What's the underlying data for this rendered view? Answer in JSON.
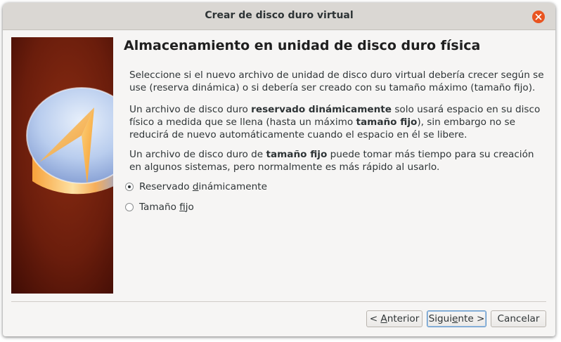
{
  "window": {
    "title": "Crear de disco duro virtual",
    "accent_color": "#e95420"
  },
  "wizard": {
    "page_title": "Almacenamiento en unidad de disco duro física",
    "para1": "Seleccione si el nuevo archivo de unidad de disco duro virtual debería crecer según se use (reserva dinámica) o si debería ser creado con su tamaño máximo (tamaño fijo).",
    "para2": {
      "t1": "Un archivo de disco duro ",
      "b1": "reservado dinámicamente",
      "t2": " solo usará espacio en su disco físico a medida que se llena (hasta un máximo ",
      "b2": "tamaño fijo",
      "t3": "), sin embargo no se reducirá de nuevo automáticamente cuando el espacio en él se libere."
    },
    "para3": {
      "t1": "Un archivo de disco duro de ",
      "b1": "tamaño fijo",
      "t2": " puede tomar más tiempo para su creación en algunos sistemas, pero normalmente es más rápido al usarlo."
    }
  },
  "options": {
    "dynamic": {
      "pre": "Reservado ",
      "mnemonic": "d",
      "post": "inámicamente",
      "selected": true
    },
    "fixed": {
      "pre": "Tamaño ",
      "mnemonic": "f",
      "post": "ijo",
      "selected": false
    }
  },
  "buttons": {
    "back": {
      "pre": "< ",
      "mnemonic": "A",
      "post": "nterior"
    },
    "next": {
      "pre": "Sigui",
      "mnemonic": "e",
      "post": "nte >"
    },
    "cancel": "Cancelar"
  },
  "icons": {
    "close": "close-icon",
    "wizard_image": "virtualbox-hard-disk-image"
  }
}
